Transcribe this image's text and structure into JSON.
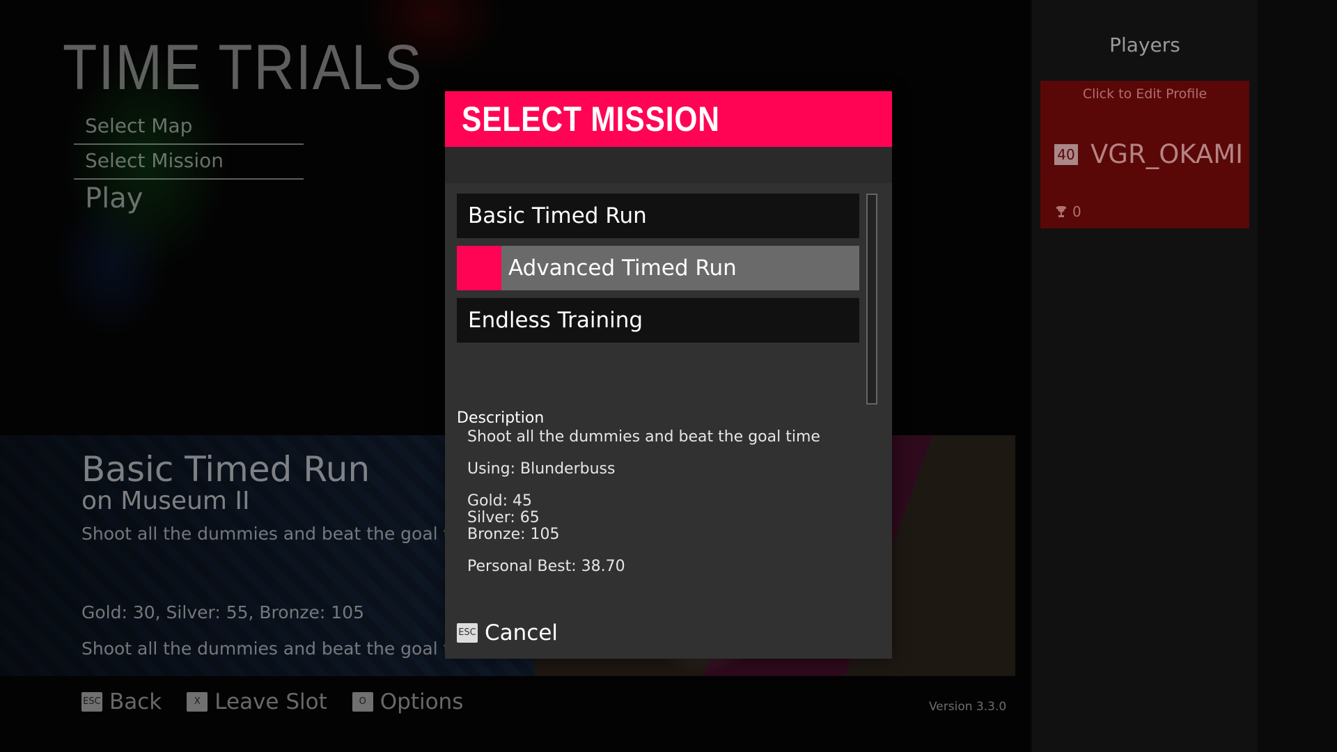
{
  "screen": {
    "title": "TIME TRIALS",
    "menu": [
      "Select Map",
      "Select Mission"
    ],
    "play_label": "Play"
  },
  "info": {
    "mission": "Basic Timed Run",
    "map": "on Museum II",
    "description": "Shoot all the dummies and beat the goal tim",
    "medals": "Gold: 30, Silver: 55, Bronze: 105",
    "description2": "Shoot all the dummies and beat the goal tim"
  },
  "footer": {
    "back": {
      "key": "ESC",
      "label": "Back"
    },
    "leave": {
      "key": "X",
      "label": "Leave Slot"
    },
    "options": {
      "key": "O",
      "label": "Options"
    },
    "version": "Version 3.3.0"
  },
  "players": {
    "title": "Players",
    "edit_hint": "Click to Edit Profile",
    "level": "40",
    "name": "VGR_OKAMI",
    "trophies": "0",
    "icon": "trophy-icon"
  },
  "modal": {
    "title": "SELECT MISSION",
    "missions": [
      "Basic Timed Run",
      "Advanced Timed Run",
      "Endless Training"
    ],
    "selected_index": 1,
    "description_label": "Description",
    "description": "Shoot all the dummies and beat the goal time",
    "using": "Using: Blunderbuss",
    "gold": "Gold: 45",
    "silver": "Silver: 65",
    "bronze": "Bronze: 105",
    "personal_best": "Personal Best: 38.70",
    "cancel": {
      "key": "ESC",
      "label": "Cancel"
    }
  },
  "colors": {
    "accent": "#ff0455",
    "player_card": "#5a0707",
    "modal_bg": "#313131"
  }
}
